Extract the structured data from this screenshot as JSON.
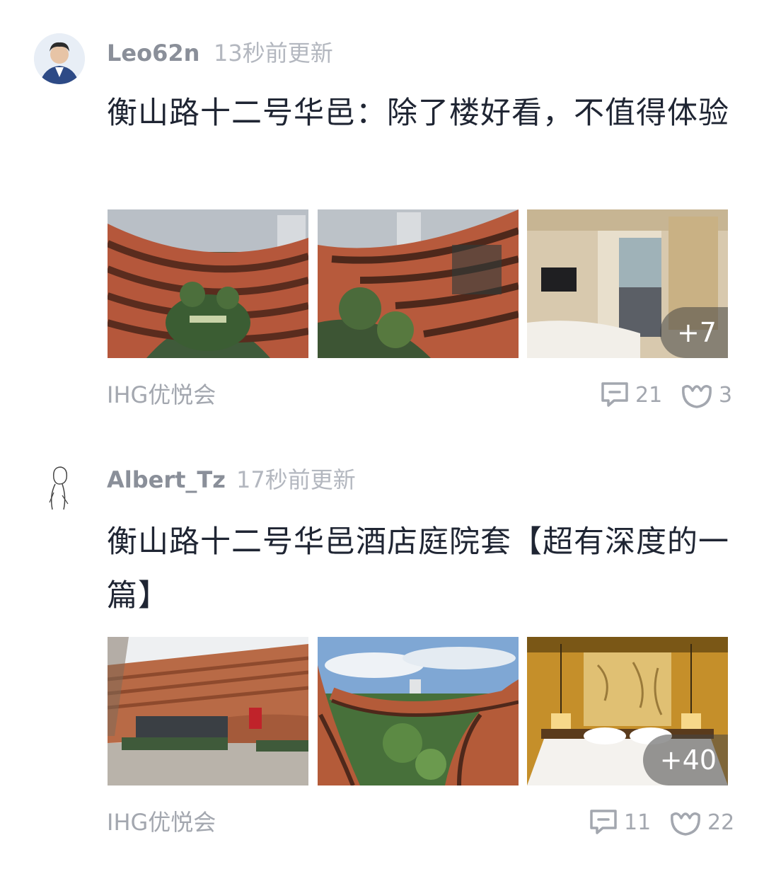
{
  "posts": [
    {
      "username": "Leo62n",
      "time": "13秒前更新",
      "title": "衡山路十二号华邑：除了楼好看，不值得体验",
      "more_count": "+7",
      "tag": "IHG优悦会",
      "comments": "21",
      "likes": "3"
    },
    {
      "username": "Albert_Tz",
      "time": "17秒前更新",
      "title": "衡山路十二号华邑酒店庭院套【超有深度的一篇】",
      "more_count": "+40",
      "tag": "IHG优悦会",
      "comments": "11",
      "likes": "22"
    }
  ],
  "icons": {
    "comment": "comment-icon",
    "like": "like-icon",
    "avatar": "avatar"
  },
  "colors": {
    "username": "#8a8f99",
    "time": "#b3b7bf",
    "title": "#1f2533",
    "meta": "#a3a7af"
  }
}
